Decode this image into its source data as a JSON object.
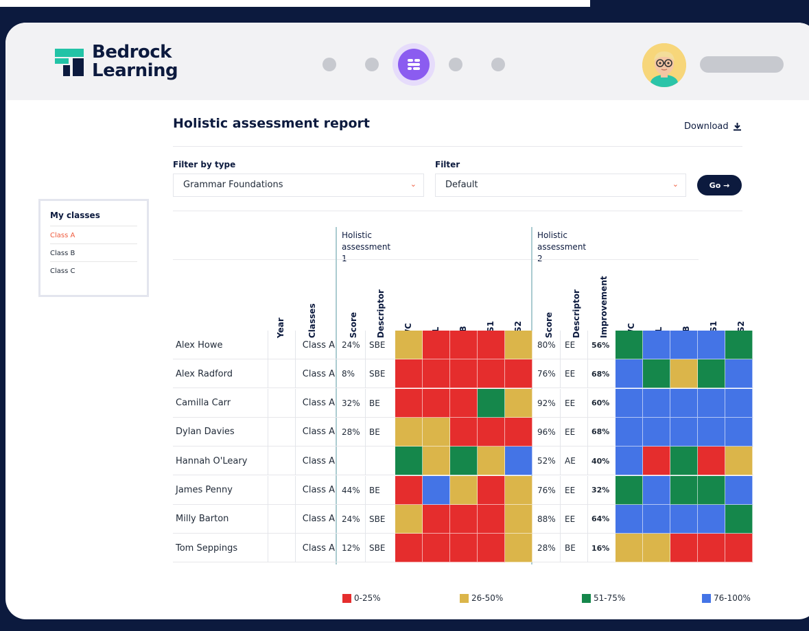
{
  "app": {
    "brand_line1": "Bedrock",
    "brand_line2": "Learning"
  },
  "colors": {
    "brand_dark": "#0c1a3e",
    "accent_orange": "#ef5a3c",
    "nav_active": "#8b5cf0",
    "heat_red": "#e52d2d",
    "heat_yellow": "#dbb54a",
    "heat_green": "#15874b",
    "heat_blue": "#4474e6"
  },
  "sidebar": {
    "title": "My classes",
    "items": [
      {
        "label": "Class A",
        "active": true
      },
      {
        "label": "Class B",
        "active": false
      },
      {
        "label": "Class C",
        "active": false
      }
    ]
  },
  "report": {
    "title": "Holistic assessment report",
    "download_label": "Download"
  },
  "filters": {
    "type_label": "Filter by type",
    "type_value": "Grammar Foundations",
    "filter_label": "Filter",
    "filter_value": "Default",
    "go_label": "Go →"
  },
  "table": {
    "group1_line1": "Holistic",
    "group1_line2": "assessment 1",
    "group2_line1": "Holistic",
    "group2_line2": "assessment 2",
    "headers": {
      "year": "Year",
      "classes": "Classes",
      "score1": "Score",
      "descriptor1": "Descriptor",
      "wc1": "WC",
      "cl1": "CL",
      "sb1": "SB",
      "ss1_1": "SS1",
      "ss2_1": "SS2",
      "score2": "Score",
      "descriptor2": "Descriptor",
      "improvement": "Improvement",
      "wc2": "WC",
      "cl2": "CL",
      "sb2": "SB",
      "ss1_2": "SS1",
      "ss2_2": "SS2"
    },
    "rows": [
      {
        "name": "Alex Howe",
        "class": "Class A",
        "score1": "24%",
        "desc1": "SBE",
        "heat1": [
          "yellow",
          "red",
          "red",
          "red",
          "yellow"
        ],
        "score2": "80%",
        "desc2": "EE",
        "improvement": "56%",
        "heat2": [
          "green",
          "blue",
          "blue",
          "blue",
          "green"
        ]
      },
      {
        "name": "Alex Radford",
        "class": "Class A",
        "score1": "8%",
        "desc1": "SBE",
        "heat1": [
          "red",
          "red",
          "red",
          "red",
          "red"
        ],
        "score2": "76%",
        "desc2": "EE",
        "improvement": "68%",
        "heat2": [
          "blue",
          "green",
          "yellow",
          "green",
          "blue"
        ]
      },
      {
        "name": "Camilla Carr",
        "class": "Class A",
        "score1": "32%",
        "desc1": "BE",
        "heat1": [
          "red",
          "red",
          "red",
          "green",
          "yellow"
        ],
        "score2": "92%",
        "desc2": "EE",
        "improvement": "60%",
        "heat2": [
          "blue",
          "blue",
          "blue",
          "blue",
          "blue"
        ]
      },
      {
        "name": "Dylan Davies",
        "class": "Class A",
        "score1": "28%",
        "desc1": "BE",
        "heat1": [
          "yellow",
          "yellow",
          "red",
          "red",
          "red"
        ],
        "score2": "96%",
        "desc2": "EE",
        "improvement": "68%",
        "heat2": [
          "blue",
          "blue",
          "blue",
          "blue",
          "blue"
        ]
      },
      {
        "name": "Hannah O'Leary",
        "class": "Class A",
        "score1": "",
        "desc1": "",
        "heat1": [
          "green",
          "yellow",
          "green",
          "yellow",
          "blue"
        ],
        "score2": "52%",
        "desc2": "AE",
        "improvement": "40%",
        "heat2": [
          "blue",
          "red",
          "green",
          "red",
          "yellow"
        ]
      },
      {
        "name": "James Penny",
        "class": "Class A",
        "score1": "44%",
        "desc1": "BE",
        "heat1": [
          "red",
          "blue",
          "yellow",
          "red",
          "yellow"
        ],
        "score2": "76%",
        "desc2": "EE",
        "improvement": "32%",
        "heat2": [
          "green",
          "blue",
          "green",
          "green",
          "blue"
        ]
      },
      {
        "name": "Milly Barton",
        "class": "Class A",
        "score1": "24%",
        "desc1": "SBE",
        "heat1": [
          "yellow",
          "red",
          "red",
          "red",
          "yellow"
        ],
        "score2": "88%",
        "desc2": "EE",
        "improvement": "64%",
        "heat2": [
          "blue",
          "blue",
          "blue",
          "blue",
          "green"
        ]
      },
      {
        "name": "Tom Seppings",
        "class": "Class A",
        "score1": "12%",
        "desc1": "SBE",
        "heat1": [
          "red",
          "red",
          "red",
          "red",
          "yellow"
        ],
        "score2": "28%",
        "desc2": "BE",
        "improvement": "16%",
        "heat2": [
          "yellow",
          "yellow",
          "red",
          "red",
          "red"
        ]
      }
    ]
  },
  "legend": [
    {
      "color": "red",
      "label": "0-25%"
    },
    {
      "color": "yellow",
      "label": "26-50%"
    },
    {
      "color": "green",
      "label": "51-75%"
    },
    {
      "color": "blue",
      "label": "76-100%"
    }
  ]
}
